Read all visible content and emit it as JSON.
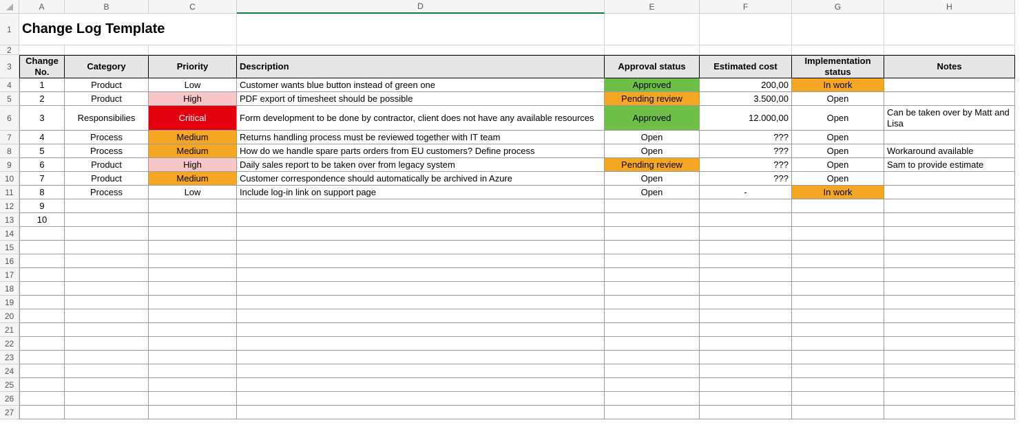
{
  "columns": [
    "A",
    "B",
    "C",
    "D",
    "E",
    "F",
    "G",
    "H"
  ],
  "row_count": 27,
  "title": "Change Log Template",
  "selected_column": "D",
  "headers": {
    "change_no": "Change No.",
    "category": "Category",
    "priority": "Priority",
    "description": "Description",
    "approval": "Approval status",
    "cost": "Estimated cost",
    "impl": "Implementation status",
    "notes": "Notes"
  },
  "status_colors": {
    "approved": "#6dbf47",
    "pending": "#f5a623",
    "inwork": "#f5a623",
    "priority_low": "",
    "priority_medium": "#f5a623",
    "priority_high": "#f7c6c6",
    "priority_critical": "#e3000f"
  },
  "rows": [
    {
      "no": "1",
      "category": "Product",
      "priority": "Low",
      "priority_class": "",
      "desc": "Customer wants blue button instead of green one",
      "approval": "Approved",
      "approval_class": "fill-green",
      "cost": "200,00",
      "impl": "In work",
      "impl_class": "fill-orange",
      "notes": ""
    },
    {
      "no": "2",
      "category": "Product",
      "priority": "High",
      "priority_class": "fill-pink",
      "desc": "PDF export of timesheet should be possible",
      "approval": "Pending review",
      "approval_class": "fill-orange",
      "cost": "3.500,00",
      "impl": "Open",
      "impl_class": "",
      "notes": ""
    },
    {
      "no": "3",
      "category": "Responsibilies",
      "priority": "Critical",
      "priority_class": "fill-red",
      "desc": "Form development to be done by contractor, client does not have any available resources",
      "approval": "Approved",
      "approval_class": "fill-green",
      "cost": "12.000,00",
      "impl": "Open",
      "impl_class": "",
      "notes": "Can be taken over by Matt and Lisa"
    },
    {
      "no": "4",
      "category": "Process",
      "priority": "Medium",
      "priority_class": "fill-orange",
      "desc": "Returns handling process must be reviewed together with IT team",
      "approval": "Open",
      "approval_class": "",
      "cost": "???",
      "impl": "Open",
      "impl_class": "",
      "notes": ""
    },
    {
      "no": "5",
      "category": "Process",
      "priority": "Medium",
      "priority_class": "fill-orange",
      "desc": "How do we handle spare parts orders from EU customers? Define process",
      "approval": "Open",
      "approval_class": "",
      "cost": "???",
      "impl": "Open",
      "impl_class": "",
      "notes": "Workaround available"
    },
    {
      "no": "6",
      "category": "Product",
      "priority": "High",
      "priority_class": "fill-pink",
      "desc": "Daily sales report to be taken over from legacy system",
      "approval": "Pending review",
      "approval_class": "fill-orange",
      "cost": "???",
      "impl": "Open",
      "impl_class": "",
      "notes": "Sam to provide estimate"
    },
    {
      "no": "7",
      "category": "Product",
      "priority": "Medium",
      "priority_class": "fill-orange",
      "desc": "Customer correspondence should automatically be archived in Azure",
      "approval": "Open",
      "approval_class": "",
      "cost": "???",
      "impl": "Open",
      "impl_class": "",
      "notes": ""
    },
    {
      "no": "8",
      "category": "Process",
      "priority": "Low",
      "priority_class": "",
      "desc": "Include log-in link on support page",
      "approval": "Open",
      "approval_class": "",
      "cost": "-",
      "impl": "In work",
      "impl_class": "fill-orange",
      "notes": ""
    },
    {
      "no": "9",
      "category": "",
      "priority": "",
      "priority_class": "",
      "desc": "",
      "approval": "",
      "approval_class": "",
      "cost": "",
      "impl": "",
      "impl_class": "",
      "notes": ""
    },
    {
      "no": "10",
      "category": "",
      "priority": "",
      "priority_class": "",
      "desc": "",
      "approval": "",
      "approval_class": "",
      "cost": "",
      "impl": "",
      "impl_class": "",
      "notes": ""
    }
  ]
}
